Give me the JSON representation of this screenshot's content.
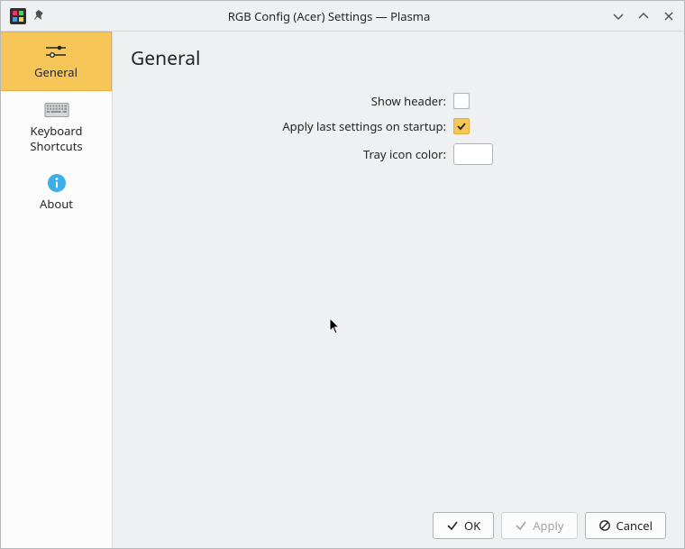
{
  "window": {
    "title": "RGB Config (Acer) Settings — Plasma"
  },
  "sidebar": {
    "items": [
      {
        "label": "General",
        "active": true
      },
      {
        "label": "Keyboard Shortcuts",
        "active": false
      },
      {
        "label": "About",
        "active": false
      }
    ]
  },
  "page": {
    "title": "General"
  },
  "form": {
    "show_header": {
      "label": "Show header:",
      "checked": false
    },
    "apply_last": {
      "label": "Apply last settings on startup:",
      "checked": true
    },
    "tray_color": {
      "label": "Tray icon color:",
      "value": "#ffffff"
    }
  },
  "buttons": {
    "ok": "OK",
    "apply": "Apply",
    "cancel": "Cancel"
  }
}
